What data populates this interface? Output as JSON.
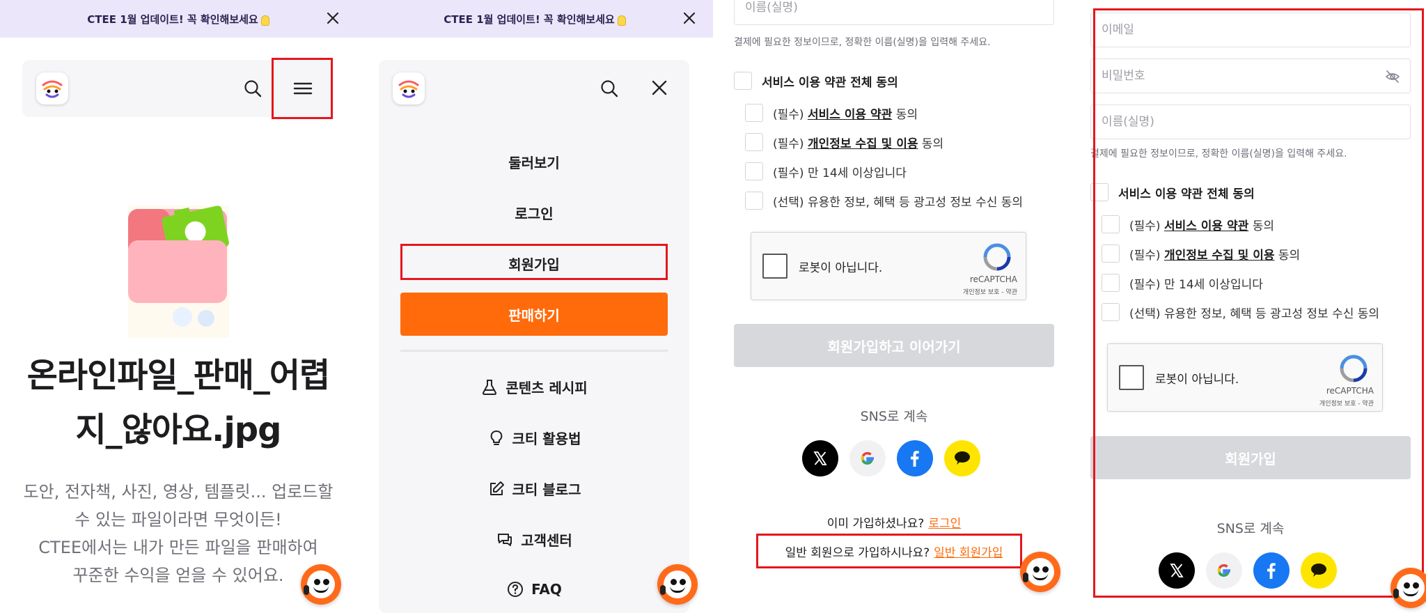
{
  "banner": {
    "text": "CTEE 1월 업데이트! 꼭 확인해보세요"
  },
  "panel1": {
    "title_line1": "온라인파일_판매_어렵",
    "title_line2": "지_않아요.jpg",
    "desc_line1": "도안, 전자책, 사진, 영상, 템플릿... 업로드할",
    "desc_line2": "수 있는 파일이라면 무엇이든!",
    "desc_line3": "CTEE에서는 내가 만든 파일을 판매하여",
    "desc_line4": "꾸준한 수익을 얻을 수 있어요."
  },
  "panel2": {
    "menu": {
      "browse": "둘러보기",
      "login": "로그인",
      "signup": "회원가입",
      "sell": "판매하기"
    },
    "links": {
      "recipe": "콘텐츠 레시피",
      "howto": "크티 활용법",
      "blog": "크티 블로그",
      "support": "고객센터",
      "faq": "FAQ"
    }
  },
  "form": {
    "email_placeholder": "이메일",
    "password_placeholder": "비밀번호",
    "name_placeholder": "이름(실명)",
    "name_hint": "결제에 필요한 정보이므로, 정확한 이름(실명)을 입력해 주세요.",
    "agree_all": "서비스 이용 약관 전체 동의",
    "req_prefix": "(필수)",
    "opt_prefix": "(선택)",
    "terms_link": "서비스 이용 약관",
    "terms_suffix": "동의",
    "privacy_link": "개인정보 수집 및 이용",
    "privacy_suffix": "동의",
    "age_text": "만 14세 이상입니다",
    "marketing_text": "유용한 정보, 혜택 등 광고성 정보 수신 동의",
    "captcha_label": "로봇이 아닙니다.",
    "captcha_brand": "reCAPTCHA",
    "captcha_links": "개인정보 보호 - 약관",
    "sns_title": "SNS로 계속"
  },
  "panel3": {
    "submit": "회원가입하고 이어가기",
    "already_text": "이미 가입하셨나요?",
    "login_link": "로그인",
    "general_text": "일반 회원으로 가입하시나요?",
    "general_link": "일반 회원가입"
  },
  "panel4": {
    "submit": "회원가입"
  },
  "colors": {
    "accent": "#ff6a0b",
    "highlight": "#e5161e",
    "banner_bg": "#ece6fb",
    "disabled": "#d7d8db"
  },
  "icons": [
    "close-icon",
    "search-icon",
    "hamburger-menu-icon",
    "flask-icon",
    "lightbulb-icon",
    "pencil-icon",
    "chat-support-icon",
    "help-circle-icon",
    "eye-off-icon",
    "recaptcha-icon",
    "x-logo-icon",
    "google-logo-icon",
    "facebook-logo-icon",
    "kakao-logo-icon",
    "mascot-icon"
  ]
}
